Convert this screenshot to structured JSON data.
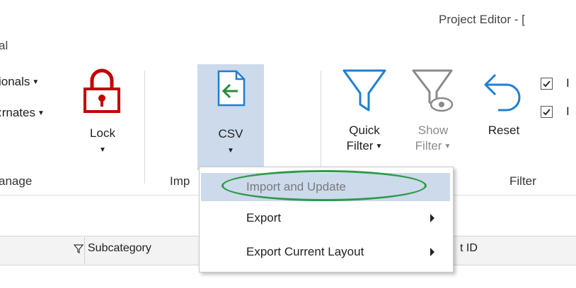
{
  "window": {
    "title": "Project Editor - ["
  },
  "ribbon": {
    "tab_fragment": "al",
    "items": {
      "conditionals": "ionals",
      "alternates": ":rnates",
      "lock": "Lock",
      "csv": "CSV",
      "quick_filter_l1": "Quick",
      "quick_filter_l2": "Filter",
      "show_filter_l1": "Show",
      "show_filter_l2": "Filter",
      "reset": "Reset",
      "check1_label": "I",
      "check2_label": "I"
    },
    "groups": {
      "manage": "anage",
      "import": "Imp",
      "filter": "Filter"
    }
  },
  "csv_menu": {
    "items": [
      {
        "label": "Import and Update",
        "has_submenu": false,
        "state": "hovered-disabled"
      },
      {
        "label": "Export",
        "has_submenu": true
      },
      {
        "label": "Export Current Layout",
        "has_submenu": true
      }
    ]
  },
  "grid": {
    "headers": {
      "subcategory": "Subcategory",
      "id_fragment": "t ID"
    }
  },
  "colors": {
    "accent_blue": "#1f7fd1",
    "lock_red": "#c00000",
    "highlight": "#ccdaeb",
    "annotation_green": "#2f9a49"
  }
}
